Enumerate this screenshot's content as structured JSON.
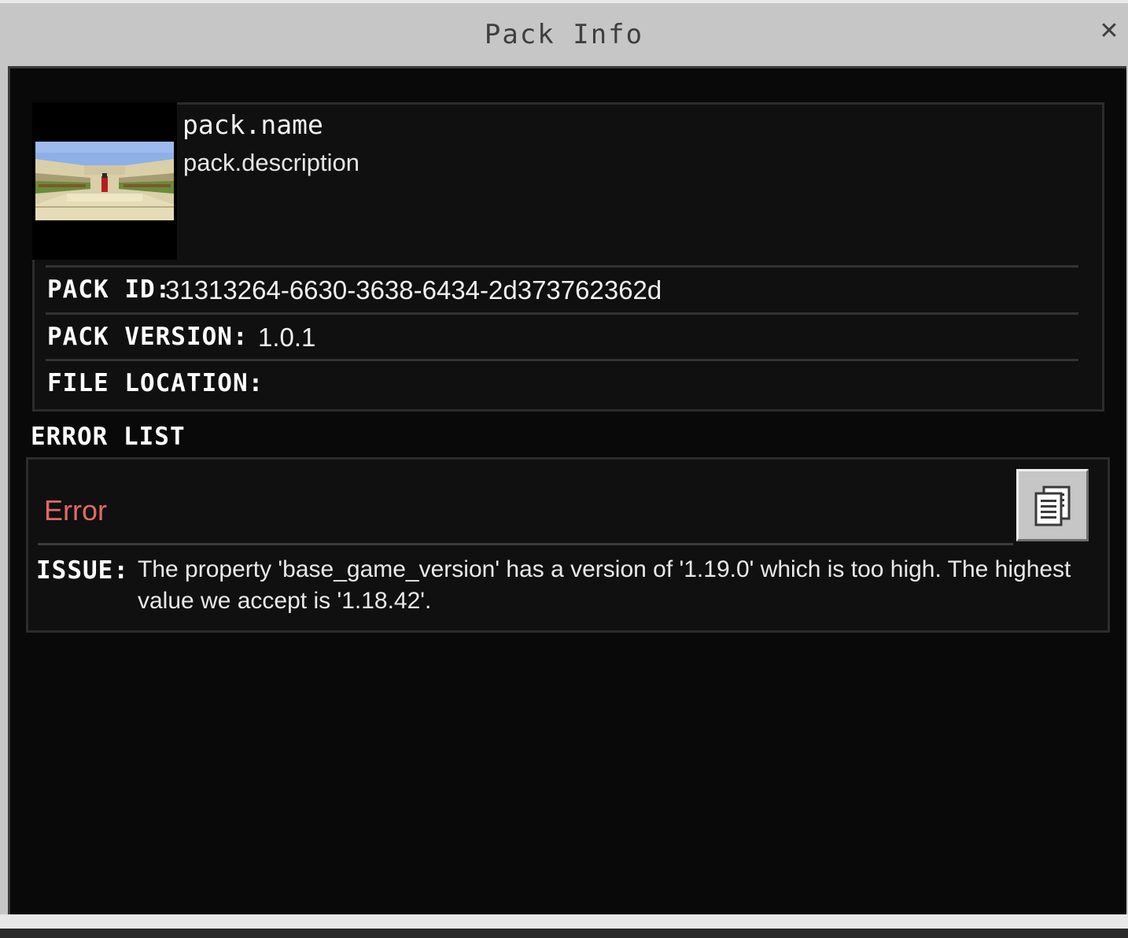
{
  "window": {
    "title": "Pack Info",
    "close_glyph": "✕"
  },
  "pack": {
    "name": "pack.name",
    "description": "pack.description",
    "thumbnail_icon": "pack-thumbnail-image"
  },
  "info": {
    "pack_id_label": "PACK ID:",
    "pack_id_value": "31313264-6630-3638-6434-2d373762362d",
    "pack_version_label": "PACK VERSION:",
    "pack_version_value": "1.0.1",
    "file_location_label": "FILE LOCATION:",
    "file_location_value": ""
  },
  "errors": {
    "heading": "ERROR LIST",
    "items": [
      {
        "title": "Error",
        "issue_label": "ISSUE:",
        "issue_text": "The property 'base_game_version' has a version of '1.19.0' which is too high. The highest value we accept is '1.18.42'.",
        "copy_icon": "copy-icon"
      }
    ]
  },
  "colors": {
    "error_red": "#e06a66",
    "panel_bg": "#101010",
    "frame_gray": "#c6c6c6"
  }
}
